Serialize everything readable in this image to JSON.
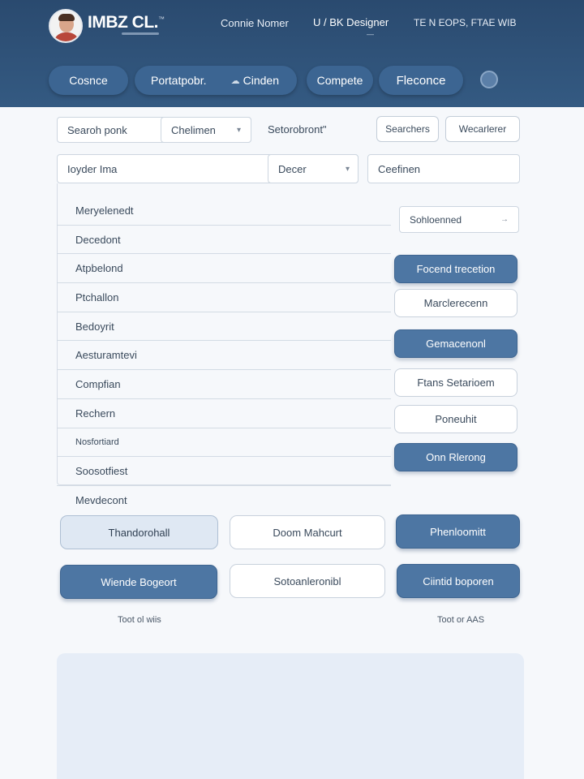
{
  "header": {
    "brand": "IMBZ CL.",
    "brand_mark": "™",
    "title": "Connie Nomer",
    "role": "U / BK Designer",
    "role_sub": "—",
    "meta": "TE N EOPS, FTAE WIB"
  },
  "nav": {
    "items": [
      "Cosnce",
      "Portatpobr.",
      "Cinden",
      "Compete",
      "Fleconce"
    ]
  },
  "filters": {
    "search_label": "Searoh ponk",
    "category_value": "Chelimen",
    "sort_label": "Setorobront\"",
    "searchers_button": "Searchers",
    "weather_button": "Wecarlerer",
    "type_label": "Ioyder Ima",
    "device_value": "Decer",
    "location_label": "Ceefinen"
  },
  "list": {
    "rows": [
      "Meryelenedt",
      "Decedont",
      "Atpbelond",
      "Ptchallon",
      "Bedoyrit",
      "Aesturamtevi",
      "Compfian",
      "Rechern",
      "Nosfortiard",
      "Soosotfiest",
      "Mevdecont"
    ]
  },
  "side_actions": {
    "select": "Sohloenned",
    "buttons": [
      {
        "label": "Focend trecetion",
        "style": "filled"
      },
      {
        "label": "Marclerecenn",
        "style": "outline"
      },
      {
        "label": "Gemacenonl",
        "style": "filled"
      },
      {
        "label": "Ftans Setarioem",
        "style": "outline"
      },
      {
        "label": "Poneuhit",
        "style": "outline"
      },
      {
        "label": "Onn Rlerong",
        "style": "filled"
      }
    ]
  },
  "actions": {
    "row1": [
      "Thandorohall",
      "Doom Mahcurt",
      "Phenloomitt"
    ],
    "row2": [
      "Wiende Bogeort",
      "Sotoanleronibl",
      "Ciintid boporen"
    ]
  },
  "footer": {
    "left": "Toot ol wiis",
    "right": "Toot or AAS"
  },
  "colors": {
    "header_bg": "#2f5279",
    "accent": "#4d76a3",
    "page_bg": "#f6f8fb"
  }
}
